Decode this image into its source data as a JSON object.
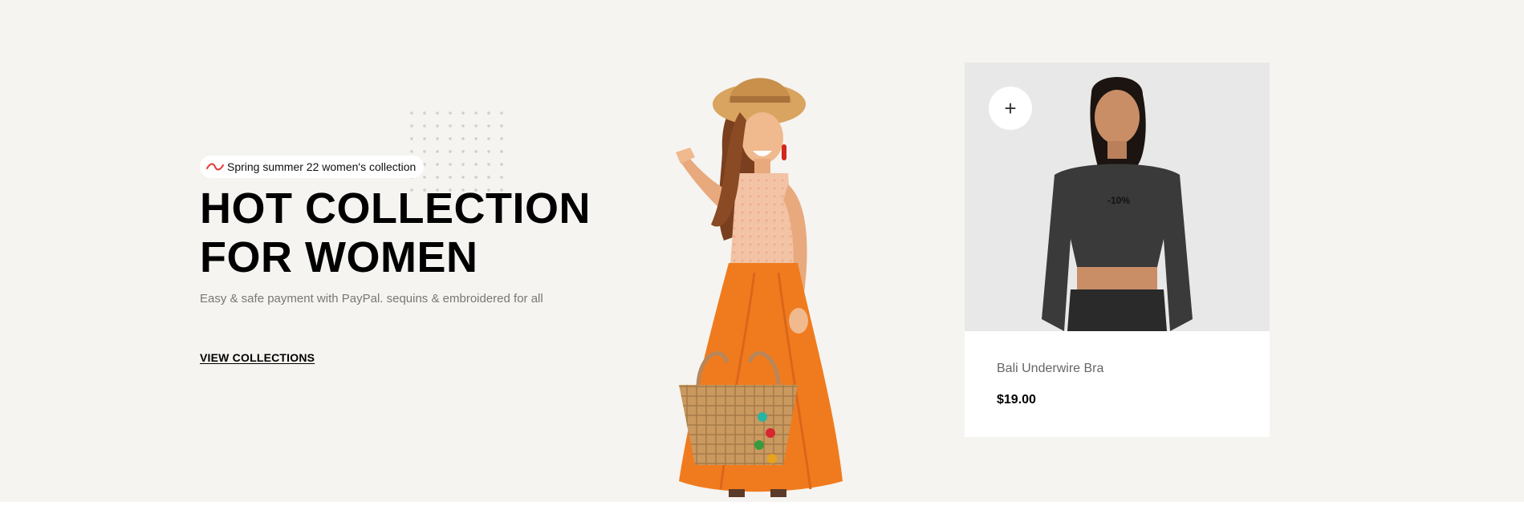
{
  "hero": {
    "tagline": "Spring summer 22 women's collection",
    "headline_line1": "HOT COLLECTION",
    "headline_line2": "FOR WOMEN",
    "subtitle": "Easy & safe payment with PayPal. sequins & embroidered for all",
    "cta_label": "VIEW COLLECTIONS",
    "accent_color": "#e53935"
  },
  "product_card": {
    "add_icon": "plus-icon",
    "discount": "-10%",
    "name": "Bali Underwire Bra",
    "price": "$19.00"
  }
}
